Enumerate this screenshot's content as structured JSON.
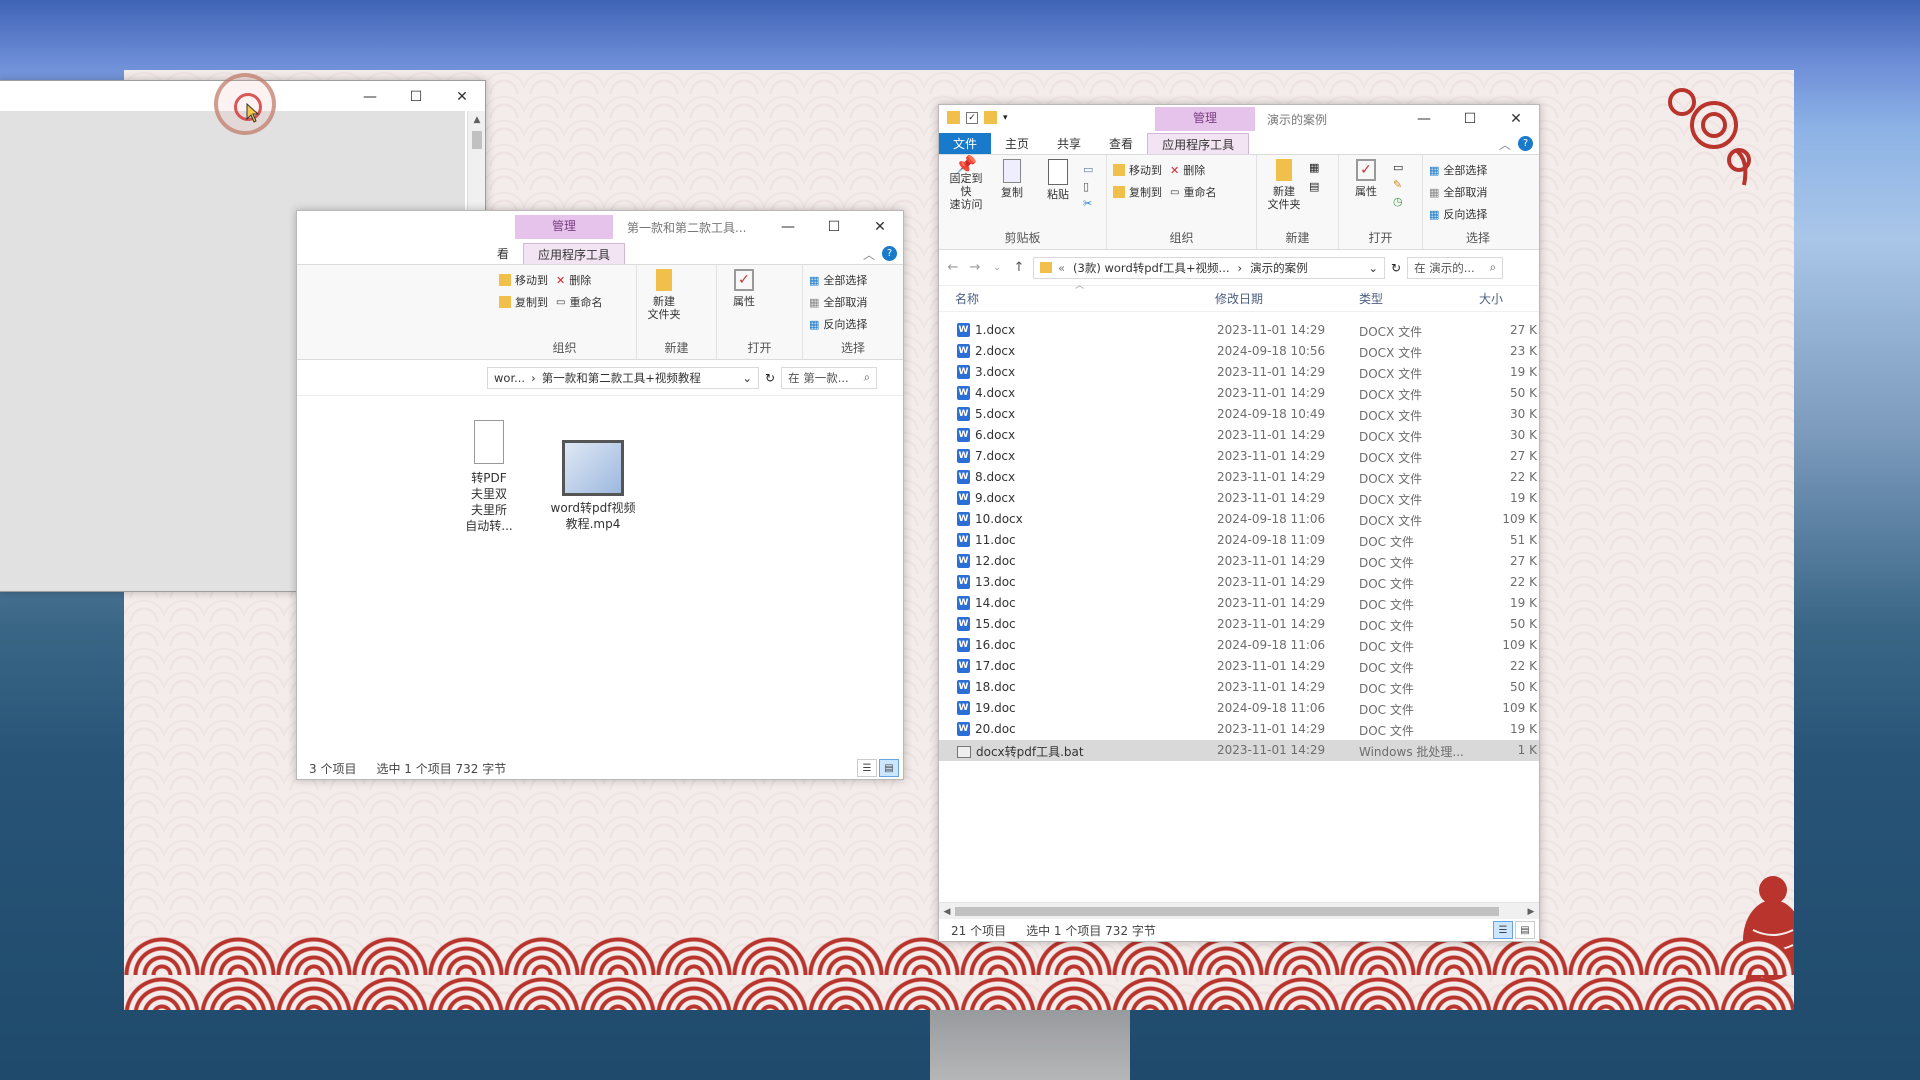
{
  "blank_window": {
    "controls": {
      "minimize": "—",
      "maximize": "☐",
      "close": "✕"
    }
  },
  "mid_explorer": {
    "manage_label": "管理",
    "title": "第一款和第二款工具...",
    "tabs": [
      "看",
      "应用程序工具"
    ],
    "ribbon": {
      "organize": {
        "move_to": "移动到",
        "copy_to": "复制到",
        "delete": "删除",
        "rename": "重命名",
        "label": "组织"
      },
      "new": {
        "new_folder": "新建\n文件夹",
        "label": "新建"
      },
      "open": {
        "properties": "属性",
        "label": "打开"
      },
      "select": {
        "select_all": "全部选择",
        "select_none": "全部取消",
        "invert": "反向选择",
        "label": "选择"
      }
    },
    "address": {
      "path_prefix": "wor...",
      "path_current": "第一款和第二款工具+视频教程",
      "search_placeholder": "在 第一款..."
    },
    "files": [
      {
        "name": "转PDF\n夫里双\n夫里所\n自动转..."
      },
      {
        "name": "word转pdf视频\n教程.mp4"
      }
    ],
    "status": {
      "count": "3 个项目",
      "selected": "选中 1 个项目  732 字节"
    }
  },
  "right_explorer": {
    "manage_label": "管理",
    "title": "演示的案例",
    "tabs": {
      "file": "文件",
      "home": "主页",
      "share": "共享",
      "view": "查看",
      "app_tools": "应用程序工具"
    },
    "ribbon": {
      "clipboard": {
        "pin": "固定到快\n速访问",
        "copy": "复制",
        "paste": "粘贴",
        "label": "剪贴板"
      },
      "organize": {
        "move_to": "移动到",
        "copy_to": "复制到",
        "delete": "删除",
        "rename": "重命名",
        "label": "组织"
      },
      "new": {
        "new_folder": "新建\n文件夹",
        "label": "新建"
      },
      "open": {
        "properties": "属性",
        "label": "打开"
      },
      "select": {
        "select_all": "全部选择",
        "select_none": "全部取消",
        "invert": "反向选择",
        "label": "选择"
      }
    },
    "address": {
      "path_parent": "(3款) word转pdf工具+视频...",
      "path_current": "演示的案例",
      "search_placeholder": "在 演示的..."
    },
    "columns": {
      "name": "名称",
      "date": "修改日期",
      "type": "类型",
      "size": "大小"
    },
    "files": [
      {
        "name": "1.docx",
        "date": "2023-11-01 14:29",
        "type": "DOCX 文件",
        "size": "27 K"
      },
      {
        "name": "2.docx",
        "date": "2024-09-18 10:56",
        "type": "DOCX 文件",
        "size": "23 K"
      },
      {
        "name": "3.docx",
        "date": "2023-11-01 14:29",
        "type": "DOCX 文件",
        "size": "19 K"
      },
      {
        "name": "4.docx",
        "date": "2023-11-01 14:29",
        "type": "DOCX 文件",
        "size": "50 K"
      },
      {
        "name": "5.docx",
        "date": "2024-09-18 10:49",
        "type": "DOCX 文件",
        "size": "30 K"
      },
      {
        "name": "6.docx",
        "date": "2023-11-01 14:29",
        "type": "DOCX 文件",
        "size": "30 K"
      },
      {
        "name": "7.docx",
        "date": "2023-11-01 14:29",
        "type": "DOCX 文件",
        "size": "27 K"
      },
      {
        "name": "8.docx",
        "date": "2023-11-01 14:29",
        "type": "DOCX 文件",
        "size": "22 K"
      },
      {
        "name": "9.docx",
        "date": "2023-11-01 14:29",
        "type": "DOCX 文件",
        "size": "19 K"
      },
      {
        "name": "10.docx",
        "date": "2024-09-18 11:06",
        "type": "DOCX 文件",
        "size": "109 K"
      },
      {
        "name": "11.doc",
        "date": "2024-09-18 11:09",
        "type": "DOC 文件",
        "size": "51 K"
      },
      {
        "name": "12.doc",
        "date": "2023-11-01 14:29",
        "type": "DOC 文件",
        "size": "27 K"
      },
      {
        "name": "13.doc",
        "date": "2023-11-01 14:29",
        "type": "DOC 文件",
        "size": "22 K"
      },
      {
        "name": "14.doc",
        "date": "2023-11-01 14:29",
        "type": "DOC 文件",
        "size": "19 K"
      },
      {
        "name": "15.doc",
        "date": "2023-11-01 14:29",
        "type": "DOC 文件",
        "size": "50 K"
      },
      {
        "name": "16.doc",
        "date": "2024-09-18 11:06",
        "type": "DOC 文件",
        "size": "109 K"
      },
      {
        "name": "17.doc",
        "date": "2023-11-01 14:29",
        "type": "DOC 文件",
        "size": "22 K"
      },
      {
        "name": "18.doc",
        "date": "2023-11-01 14:29",
        "type": "DOC 文件",
        "size": "50 K"
      },
      {
        "name": "19.doc",
        "date": "2024-09-18 11:06",
        "type": "DOC 文件",
        "size": "109 K"
      },
      {
        "name": "20.doc",
        "date": "2023-11-01 14:29",
        "type": "DOC 文件",
        "size": "19 K"
      },
      {
        "name": "docx转pdf工具.bat",
        "date": "2023-11-01 14:29",
        "type": "Windows 批处理...",
        "size": "1 K",
        "selected": true
      }
    ],
    "status": {
      "count": "21 个项目",
      "selected": "选中 1 个项目  732 字节"
    }
  },
  "colors": {
    "accent": "#1979ca",
    "manage_tab": "#e6c3ea",
    "ornament_red": "#b8342c",
    "card_bg": "#f4ecea"
  },
  "icons": [
    "close-icon",
    "minimize-icon",
    "maximize-icon",
    "help-icon",
    "folder-icon",
    "doc-icon",
    "bat-icon",
    "video-icon",
    "refresh-icon",
    "search-icon",
    "pin-icon",
    "copy-icon",
    "paste-icon",
    "delete-icon",
    "rename-icon",
    "properties-icon"
  ]
}
